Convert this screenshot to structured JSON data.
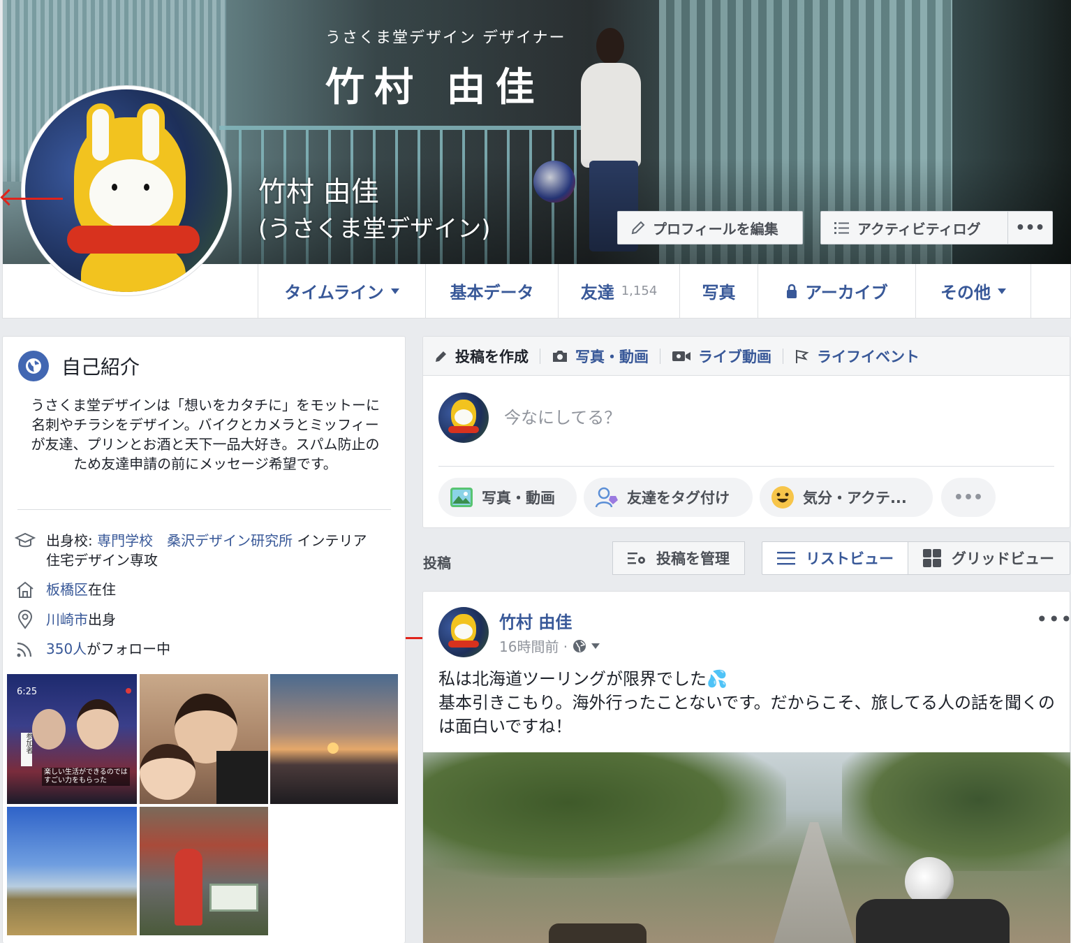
{
  "cover": {
    "subtitle": "うさくま堂デザイン デザイナー",
    "big_name": "竹村 由佳",
    "profile_name": "竹村 由佳",
    "profile_subname": "(うさくま堂デザイン)",
    "edit_profile_label": "プロフィールを編集",
    "activity_log_label": "アクティビティログ",
    "more_label": "•••"
  },
  "nav": {
    "tabs": [
      {
        "label": "タイムライン"
      },
      {
        "label": "基本データ"
      },
      {
        "label": "友達",
        "count": "1,154"
      },
      {
        "label": "写真"
      },
      {
        "label": "アーカイブ"
      },
      {
        "label": "その他"
      }
    ]
  },
  "intro": {
    "title": "自己紹介",
    "bio": "うさくま堂デザインは「想いをカタチに」をモットーに名刺やチラシをデザイン。バイクとカメラとミッフィーが友達、プリンとお酒と天下一品大好き。スパム防止のため友達申請の前にメッセージ希望です。",
    "education_prefix": "出身校: ",
    "education_link1": "専門学校",
    "education_link2": "桑沢デザイン研究所",
    "education_suffix": " インテリア住宅デザイン専攻",
    "residence_link": "板橋区",
    "residence_suffix": "在住",
    "hometown_link": "川崎市",
    "hometown_suffix": "出身",
    "followers_link": "350人",
    "followers_suffix": "がフォロー中"
  },
  "photos": {
    "tv_time": "6:25",
    "tv_caption_line1": "楽しい生活ができるのでは",
    "tv_caption_line2": "すごい力をもらった",
    "tv_badge": "参加者"
  },
  "composer": {
    "tabs": [
      {
        "label": "投稿を作成"
      },
      {
        "label": "写真・動画"
      },
      {
        "label": "ライブ動画"
      },
      {
        "label": "ライフイベント"
      }
    ],
    "placeholder": "今なにしてる？",
    "pills": [
      {
        "label": "写真・動画"
      },
      {
        "label": "友達をタグ付け"
      },
      {
        "label": "気分・アクテ..."
      }
    ],
    "more_label": "•••"
  },
  "posts_section": {
    "label": "投稿",
    "manage_label": "投稿を管理",
    "list_view_label": "リストビュー",
    "grid_view_label": "グリッドビュー"
  },
  "post": {
    "author": "竹村 由佳",
    "time": "16時間前 · ",
    "text_line1": "私は北海道ツーリングが限界でした💦",
    "text_line2": "基本引きこもり。海外行ったことないです。だからこそ、旅してる人の話を聞くのは面白いですね！",
    "more_label": "•••"
  },
  "colors": {
    "link": "#385898",
    "background": "#e9ebee",
    "annotation_arrow": "#e0231b",
    "accent": "#4267b2"
  }
}
